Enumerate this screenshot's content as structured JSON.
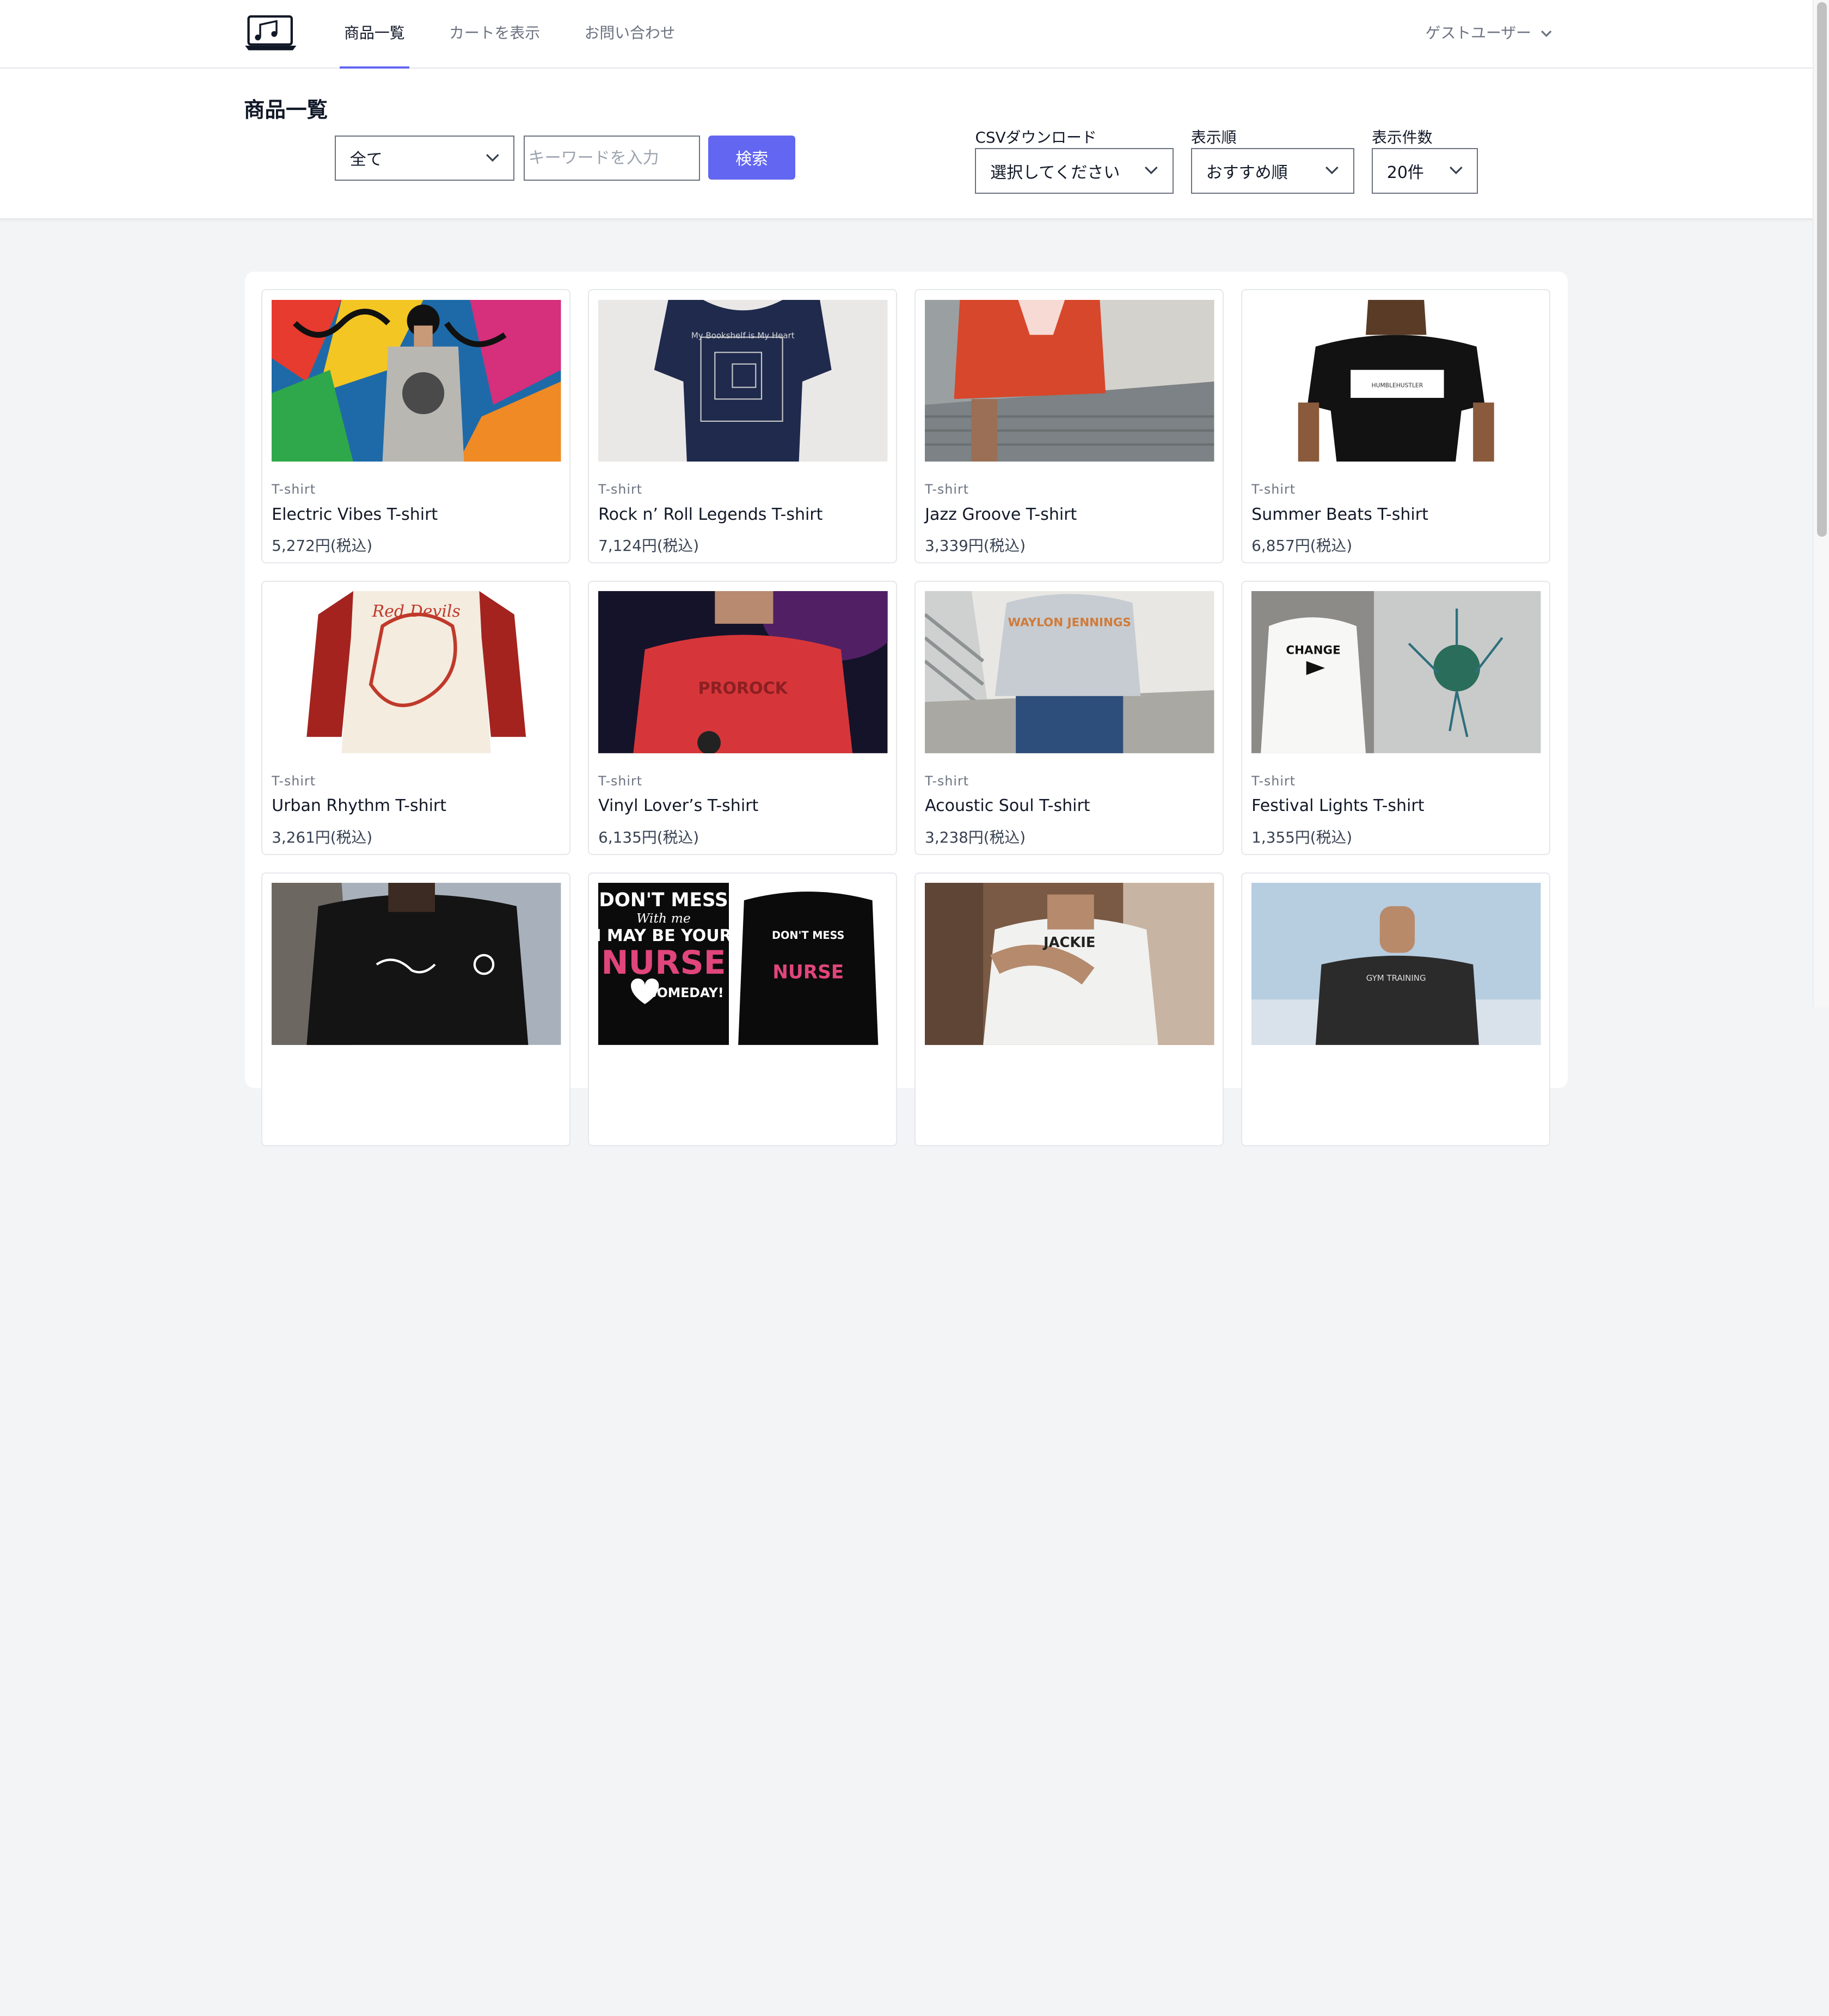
{
  "nav": {
    "items": [
      {
        "label": "商品一覧",
        "active": true
      },
      {
        "label": "カートを表示",
        "active": false
      },
      {
        "label": "お問い合わせ",
        "active": false
      }
    ],
    "user_label": "ゲストユーザー"
  },
  "toolbar": {
    "page_title": "商品一覧",
    "category_value": "全て",
    "keyword_placeholder": "キーワードを入力",
    "search_label": "検索",
    "csv_label": "CSVダウンロード",
    "csv_value": "選択してください",
    "sort_label": "表示順",
    "sort_value": "おすすめ順",
    "count_label": "表示件数",
    "count_value": "20件"
  },
  "products": [
    {
      "category": "T-shirt",
      "name": "Electric Vibes T-shirt",
      "price": "5,272円(税込)"
    },
    {
      "category": "T-shirt",
      "name": "Rock n’ Roll Legends T-shirt",
      "price": "7,124円(税込)"
    },
    {
      "category": "T-shirt",
      "name": "Jazz Groove T-shirt",
      "price": "3,339円(税込)"
    },
    {
      "category": "T-shirt",
      "name": "Summer Beats T-shirt",
      "price": "6,857円(税込)"
    },
    {
      "category": "T-shirt",
      "name": "Urban Rhythm T-shirt",
      "price": "3,261円(税込)"
    },
    {
      "category": "T-shirt",
      "name": "Vinyl Lover’s T-shirt",
      "price": "6,135円(税込)"
    },
    {
      "category": "T-shirt",
      "name": "Acoustic Soul T-shirt",
      "price": "3,238円(税込)"
    },
    {
      "category": "T-shirt",
      "name": "Festival Lights T-shirt",
      "price": "1,355円(税込)"
    },
    {
      "category": "",
      "name": "",
      "price": ""
    },
    {
      "category": "",
      "name": "",
      "price": ""
    },
    {
      "category": "",
      "name": "",
      "price": ""
    },
    {
      "category": "",
      "name": "",
      "price": ""
    }
  ],
  "image_text": {
    "bookshelf": "My Bookshelf is My Heart",
    "humble": "HUMBLEHUSTLER",
    "devils": "Red Devils",
    "prorock": "PROROCK",
    "waylon": "WAYLON JENNINGS",
    "change": "CHANGE",
    "nurse_1": "DON'T MESS",
    "nurse_2": "With me",
    "nurse_3": "I MAY BE YOUR",
    "nurse_4": "NURSE",
    "nurse_5": "SOMEDAY!",
    "training": "GYM TRAINING"
  },
  "colors": {
    "accent": "#6366f1",
    "page_bg": "#f3f4f6"
  }
}
